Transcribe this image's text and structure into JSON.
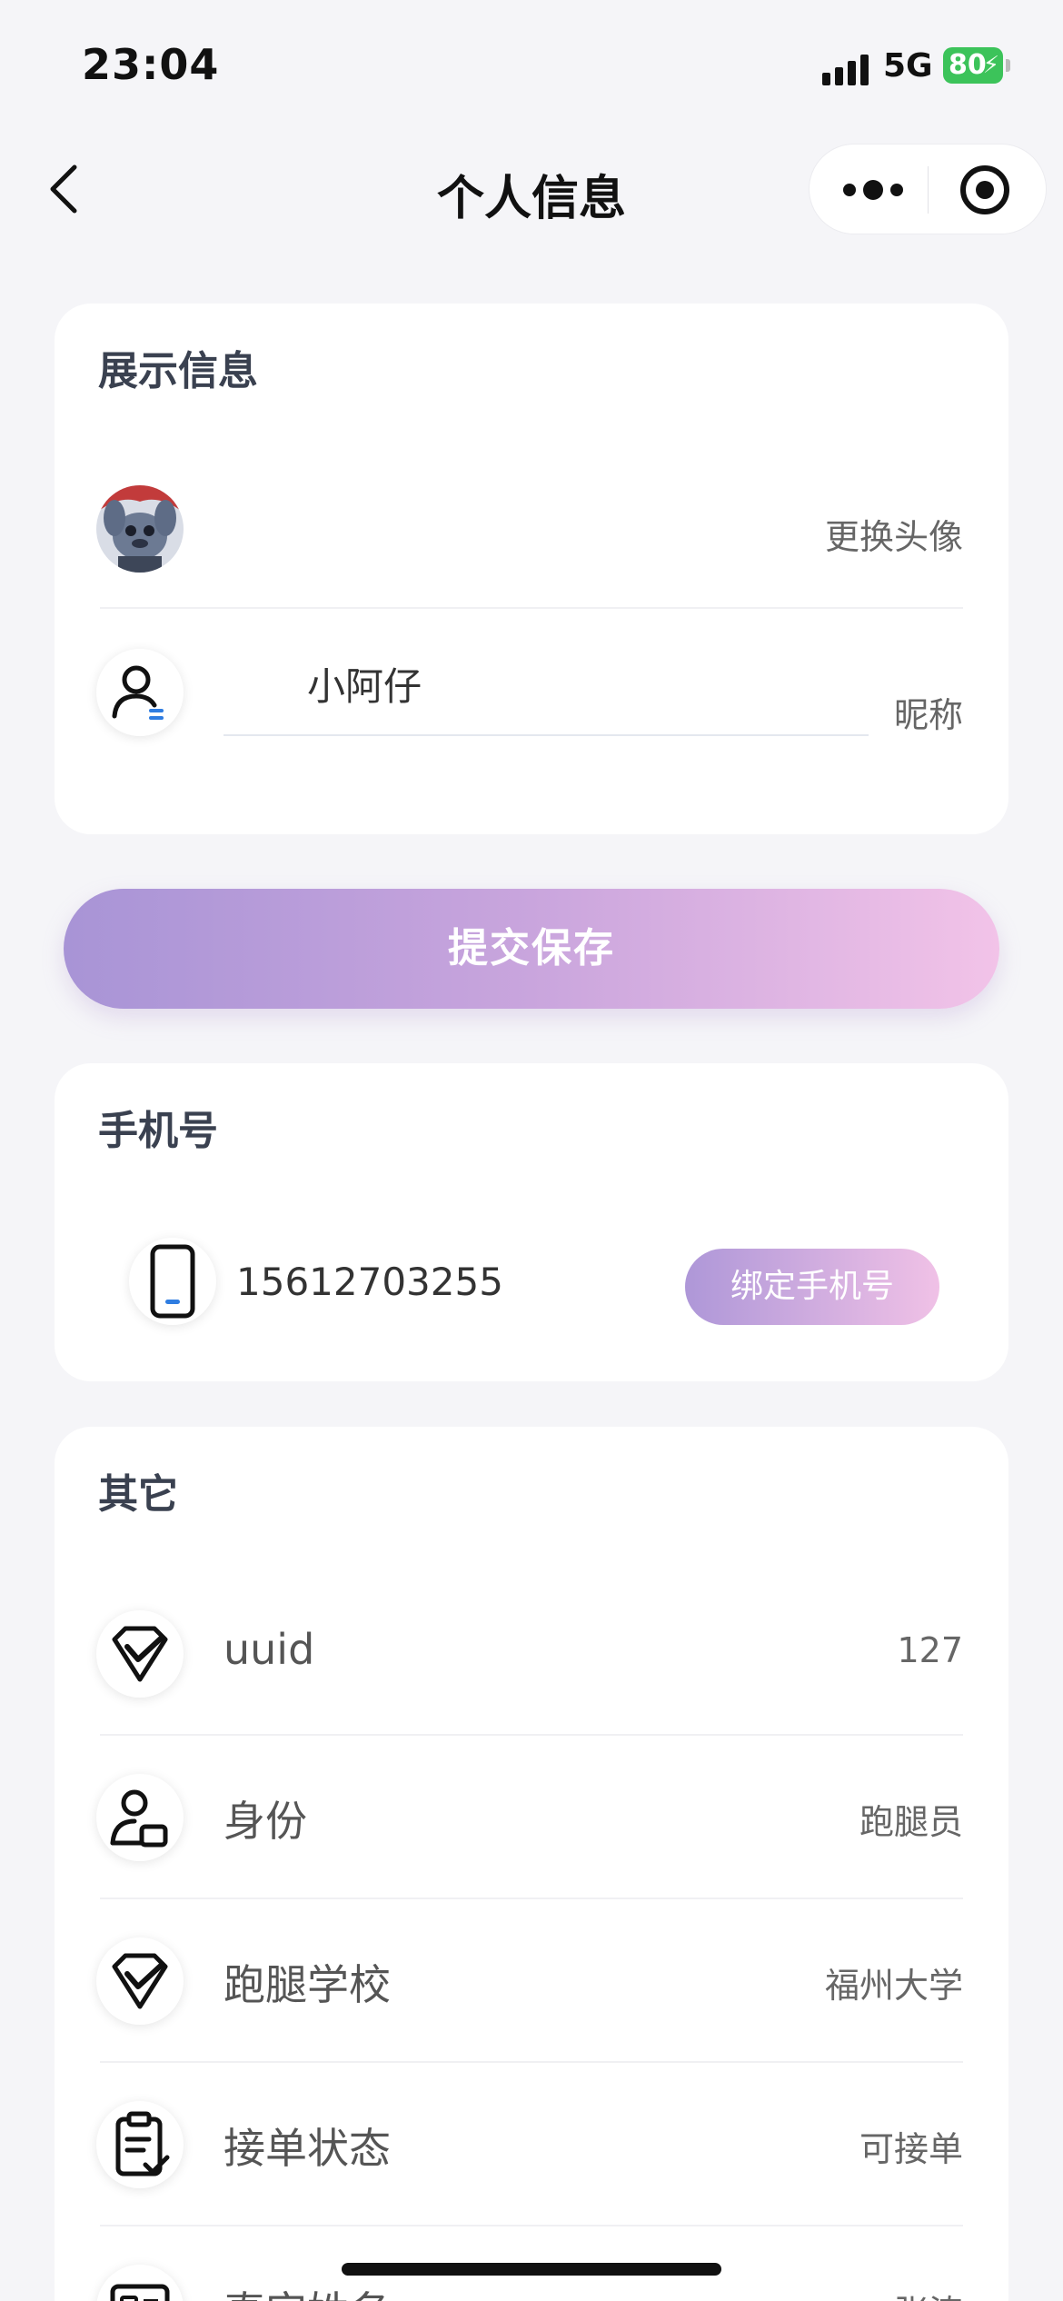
{
  "status_bar": {
    "time": "23:04",
    "network": "5G",
    "battery": "80"
  },
  "nav": {
    "title": "个人信息"
  },
  "display_info": {
    "header": "展示信息",
    "avatar_action": "更换头像",
    "nickname_value": "小阿仔",
    "nickname_label": "昵称"
  },
  "submit_label": "提交保存",
  "phone": {
    "header": "手机号",
    "number": "15612703255",
    "bind_label": "绑定手机号"
  },
  "other": {
    "header": "其它",
    "items": [
      {
        "label": "uuid",
        "value": "127",
        "icon": "shield-check-icon"
      },
      {
        "label": "身份",
        "value": "跑腿员",
        "icon": "user-card-icon"
      },
      {
        "label": "跑腿学校",
        "value": "福州大学",
        "icon": "shield-check-icon"
      },
      {
        "label": "接单状态",
        "value": "可接单",
        "icon": "clipboard-check-icon"
      },
      {
        "label": "真实姓名",
        "value": "张涛",
        "icon": "id-card-icon"
      }
    ]
  },
  "colors": {
    "accent_start": "#a894d6",
    "accent_end": "#f2c3e8",
    "battery": "#3cc35a"
  }
}
